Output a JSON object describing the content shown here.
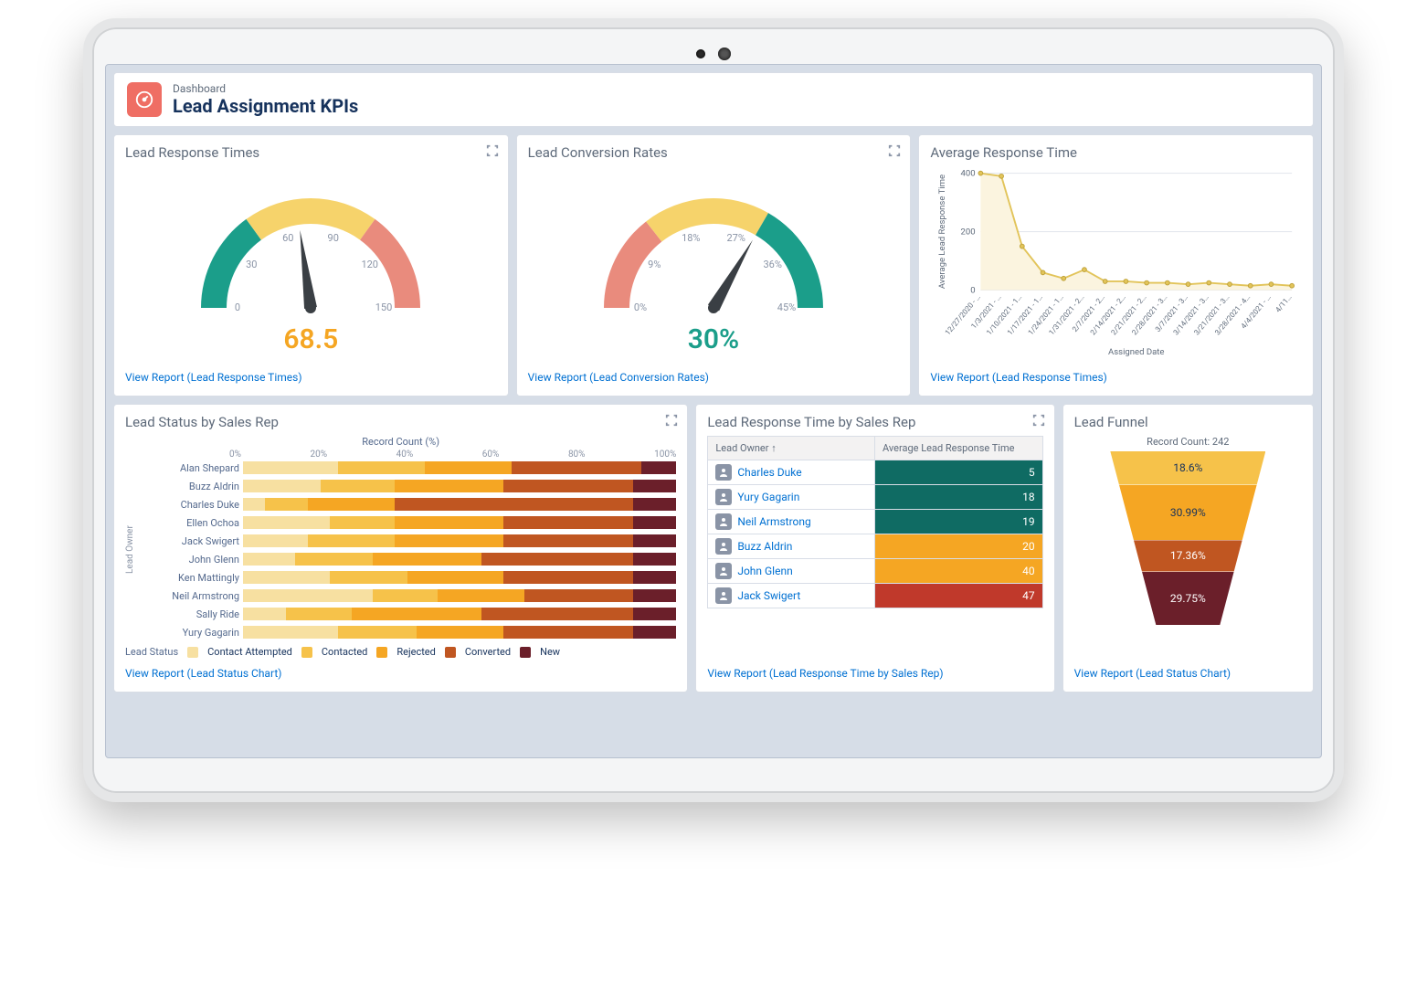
{
  "header": {
    "eyebrow": "Dashboard",
    "title": "Lead Assignment KPIs"
  },
  "cards": {
    "response_gauge": {
      "title": "Lead Response Times",
      "value_text": "68.5",
      "report_link": "View Report (Lead Response Times)"
    },
    "conversion_gauge": {
      "title": "Lead Conversion Rates",
      "value_text": "30%",
      "report_link": "View Report (Lead Conversion Rates)"
    },
    "avg_response": {
      "title": "Average Response Time",
      "y_axis_title": "Average Lead Response Time",
      "x_axis_title": "Assigned Date",
      "report_link": "View Report (Lead Response Times)"
    },
    "status_by_rep": {
      "title": "Lead Status by Sales Rep",
      "x_axis_title": "Record Count (%)",
      "y_axis_title": "Lead Owner",
      "legend_label": "Lead Status",
      "legend_items": [
        "Contact Attempted",
        "Contacted",
        "Rejected",
        "Converted",
        "New"
      ],
      "x_ticks": [
        "0%",
        "20%",
        "40%",
        "60%",
        "80%",
        "100%"
      ],
      "report_link": "View Report (Lead Status Chart)"
    },
    "rt_by_rep": {
      "title": "Lead Response Time by Sales Rep",
      "col1": "Lead Owner  ↑",
      "col2": "Average Lead Response Time",
      "report_link": "View Report (Lead Response Time by Sales Rep)"
    },
    "funnel": {
      "title": "Lead Funnel",
      "count_label": "Record Count: 242",
      "report_link": "View Report (Lead Status Chart)"
    }
  },
  "colors": {
    "teal": "#1b9e8a",
    "yellow": "#f6d36b",
    "salmon": "#e98b7d",
    "orange": "#f5a623",
    "dorange": "#d9822b",
    "brick": "#c05621",
    "maroon": "#6b1f2a",
    "cream": "#f7e0a1",
    "gridgrey": "#e1e5eb"
  },
  "chart_data": [
    {
      "id": "response_gauge",
      "type": "gauge",
      "title": "Lead Response Times",
      "value": 68.5,
      "min": 0,
      "max": 150,
      "ticks": [
        0,
        30,
        60,
        90,
        120,
        150
      ],
      "zones": [
        {
          "from": 0,
          "to": 45,
          "color": "#1b9e8a"
        },
        {
          "from": 45,
          "to": 105,
          "color": "#f6d36b"
        },
        {
          "from": 105,
          "to": 150,
          "color": "#e98b7d"
        }
      ]
    },
    {
      "id": "conversion_gauge",
      "type": "gauge",
      "title": "Lead Conversion Rates",
      "value": 30,
      "unit": "%",
      "min": 0,
      "max": 45,
      "ticks": [
        0,
        9,
        18,
        27,
        36,
        45
      ],
      "zones": [
        {
          "from": 0,
          "to": 13,
          "color": "#e98b7d"
        },
        {
          "from": 13,
          "to": 30,
          "color": "#f6d36b"
        },
        {
          "from": 30,
          "to": 45,
          "color": "#1b9e8a"
        }
      ]
    },
    {
      "id": "avg_response_line",
      "type": "line",
      "title": "Average Response Time",
      "xlabel": "Assigned Date",
      "ylabel": "Average Lead Response Time",
      "ylim": [
        0,
        400
      ],
      "yticks": [
        0,
        200,
        400
      ],
      "categories": [
        "12/27/2020 - …",
        "1/3/2021 - …",
        "1/10/2021 - 1…",
        "1/17/2021 - 1…",
        "1/24/2021 - 1…",
        "1/31/2021 - 2…",
        "2/7/2021 - 2…",
        "2/14/2021 - 2…",
        "2/21/2021 - 2…",
        "2/28/2021 - 3…",
        "3/7/2021 - 3…",
        "3/14/2021 - 3…",
        "3/21/2021 - 3…",
        "3/28/2021 - 4…",
        "4/4/2021 - …",
        "4/11…"
      ],
      "values": [
        400,
        390,
        150,
        60,
        40,
        70,
        30,
        30,
        25,
        25,
        20,
        25,
        20,
        15,
        20,
        15
      ]
    },
    {
      "id": "status_by_rep_stacked",
      "type": "bar",
      "stacked": true,
      "orientation": "horizontal",
      "xlabel": "Record Count (%)",
      "ylabel": "Lead Owner",
      "xlim": [
        0,
        100
      ],
      "categories": [
        "Alan Shepard",
        "Buzz Aldrin",
        "Charles Duke",
        "Ellen Ochoa",
        "Jack Swigert",
        "John Glenn",
        "Ken Mattingly",
        "Neil Armstrong",
        "Sally Ride",
        "Yury Gagarin"
      ],
      "series": [
        {
          "name": "Contact Attempted",
          "color": "#f7e0a1",
          "values": [
            22,
            18,
            5,
            20,
            15,
            12,
            20,
            30,
            10,
            22
          ]
        },
        {
          "name": "Contacted",
          "color": "#f6c24a",
          "values": [
            20,
            17,
            10,
            15,
            20,
            18,
            18,
            15,
            15,
            18
          ]
        },
        {
          "name": "Rejected",
          "color": "#f5a623",
          "values": [
            20,
            25,
            20,
            25,
            25,
            25,
            22,
            20,
            30,
            20
          ]
        },
        {
          "name": "Converted",
          "color": "#c05621",
          "values": [
            30,
            30,
            55,
            30,
            30,
            35,
            30,
            25,
            35,
            30
          ]
        },
        {
          "name": "New",
          "color": "#6b1f2a",
          "values": [
            8,
            10,
            10,
            10,
            10,
            10,
            10,
            10,
            10,
            10
          ]
        }
      ]
    },
    {
      "id": "rt_by_rep_table",
      "type": "table",
      "columns": [
        "Lead Owner",
        "Average Lead Response Time"
      ],
      "rows": [
        {
          "owner": "Charles Duke",
          "value": 5,
          "color": "#0f6b63"
        },
        {
          "owner": "Yury Gagarin",
          "value": 18,
          "color": "#0f6b63"
        },
        {
          "owner": "Neil Armstrong",
          "value": 19,
          "color": "#0f6b63"
        },
        {
          "owner": "Buzz Aldrin",
          "value": 20,
          "color": "#f5a623"
        },
        {
          "owner": "John Glenn",
          "value": 40,
          "color": "#f5a623"
        },
        {
          "owner": "Jack Swigert",
          "value": 47,
          "color": "#c0392b"
        }
      ]
    },
    {
      "id": "lead_funnel",
      "type": "funnel",
      "title": "Record Count: 242",
      "segments": [
        {
          "label": "18.6%",
          "value": 18.6,
          "color": "#f6c24a"
        },
        {
          "label": "30.99%",
          "value": 30.99,
          "color": "#f5a623"
        },
        {
          "label": "17.36%",
          "value": 17.36,
          "color": "#c05621"
        },
        {
          "label": "29.75%",
          "value": 29.75,
          "color": "#6b1f2a"
        }
      ]
    }
  ]
}
